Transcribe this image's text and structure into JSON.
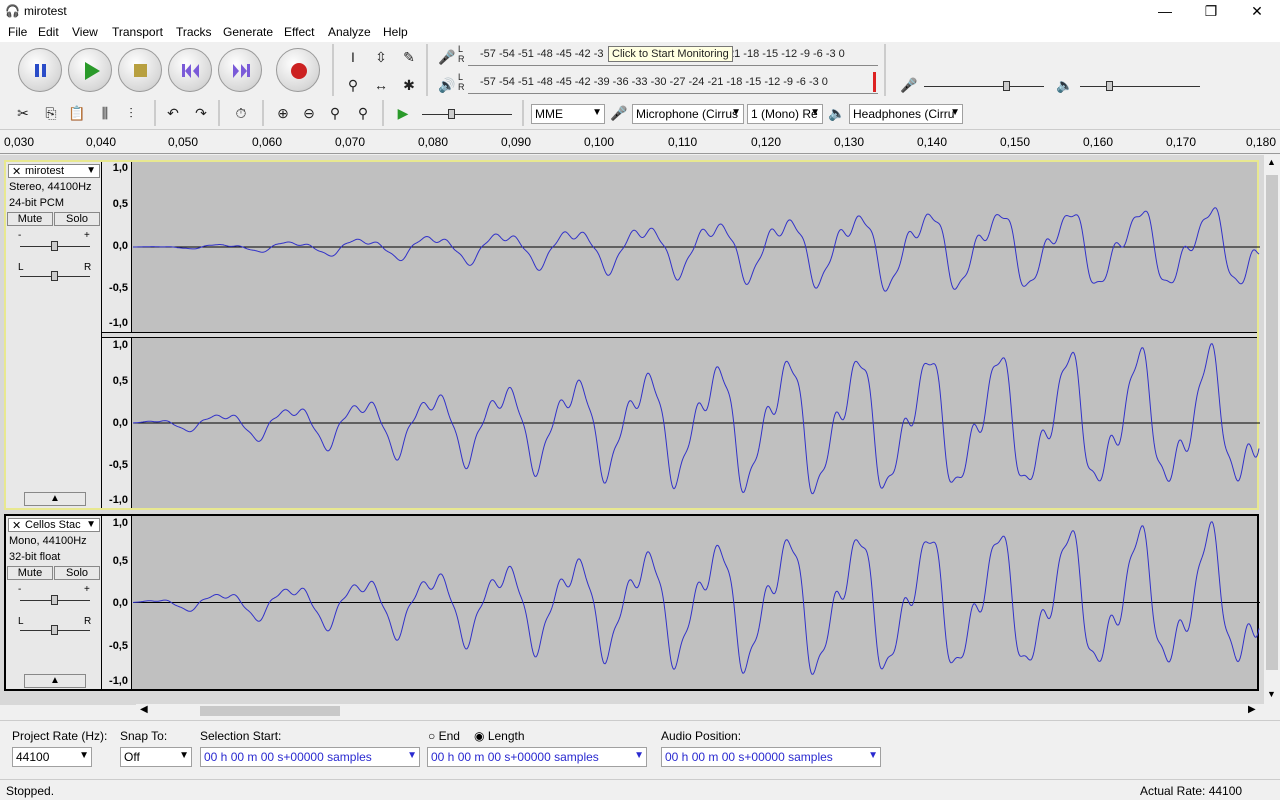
{
  "window": {
    "title": "mirotest",
    "minimize": "—",
    "maximize": "❐",
    "close": "✕"
  },
  "menu": [
    "File",
    "Edit",
    "View",
    "Transport",
    "Tracks",
    "Generate",
    "Effect",
    "Analyze",
    "Help"
  ],
  "transport": {
    "pause": "Pause",
    "play": "Play",
    "stop": "Stop",
    "skip_start": "Skip to Start",
    "skip_end": "Skip to End",
    "record": "Record"
  },
  "meters": {
    "scale": "-57 -54 -51 -48 -45 -42 -3",
    "scale_end": "21 -18 -15 -12  -9  -6  -3  0",
    "scale2": "-57 -54 -51 -48 -45 -42 -39 -36 -33 -30 -27 -24 -21 -18 -15 -12  -9  -6  -3  0",
    "tooltip": "Click to Start Monitoring",
    "lr": "L\nR"
  },
  "device": {
    "host": "MME",
    "mic": "Microphone (Cirrus",
    "channels": "1 (Mono) Re",
    "output": "Headphones (Cirru"
  },
  "ruler": [
    "0,030",
    "0,040",
    "0,050",
    "0,060",
    "0,070",
    "0,080",
    "0,090",
    "0,100",
    "0,110",
    "0,120",
    "0,130",
    "0,140",
    "0,150",
    "0,160",
    "0,170",
    "0,180"
  ],
  "tracks": [
    {
      "name": "mirotest",
      "info1": "Stereo, 44100Hz",
      "info2": "24-bit PCM",
      "mute": "Mute",
      "solo": "Solo",
      "gain_minus": "-",
      "gain_plus": "+",
      "pan_l": "L",
      "pan_r": "R"
    },
    {
      "name": "Cellos Stac",
      "info1": "Mono, 44100Hz",
      "info2": "32-bit float",
      "mute": "Mute",
      "solo": "Solo",
      "gain_minus": "-",
      "gain_plus": "+",
      "pan_l": "L",
      "pan_r": "R"
    }
  ],
  "vscale": [
    "1,0",
    "0,5",
    "0,0",
    "-0,5",
    "-1,0"
  ],
  "selbar": {
    "rate_label": "Project Rate (Hz):",
    "rate": "44100",
    "snap_label": "Snap To:",
    "snap": "Off",
    "sel_start": "Selection Start:",
    "end": "End",
    "length": "Length",
    "audio_pos": "Audio Position:",
    "time": "00 h 00 m 00 s+00000 samples"
  },
  "status": {
    "state": "Stopped.",
    "actual_rate": "Actual Rate: 44100"
  },
  "colors": {
    "wave": "#3232c8",
    "track_bg": "#c0c0c0",
    "selected_border": "#e8e890"
  }
}
